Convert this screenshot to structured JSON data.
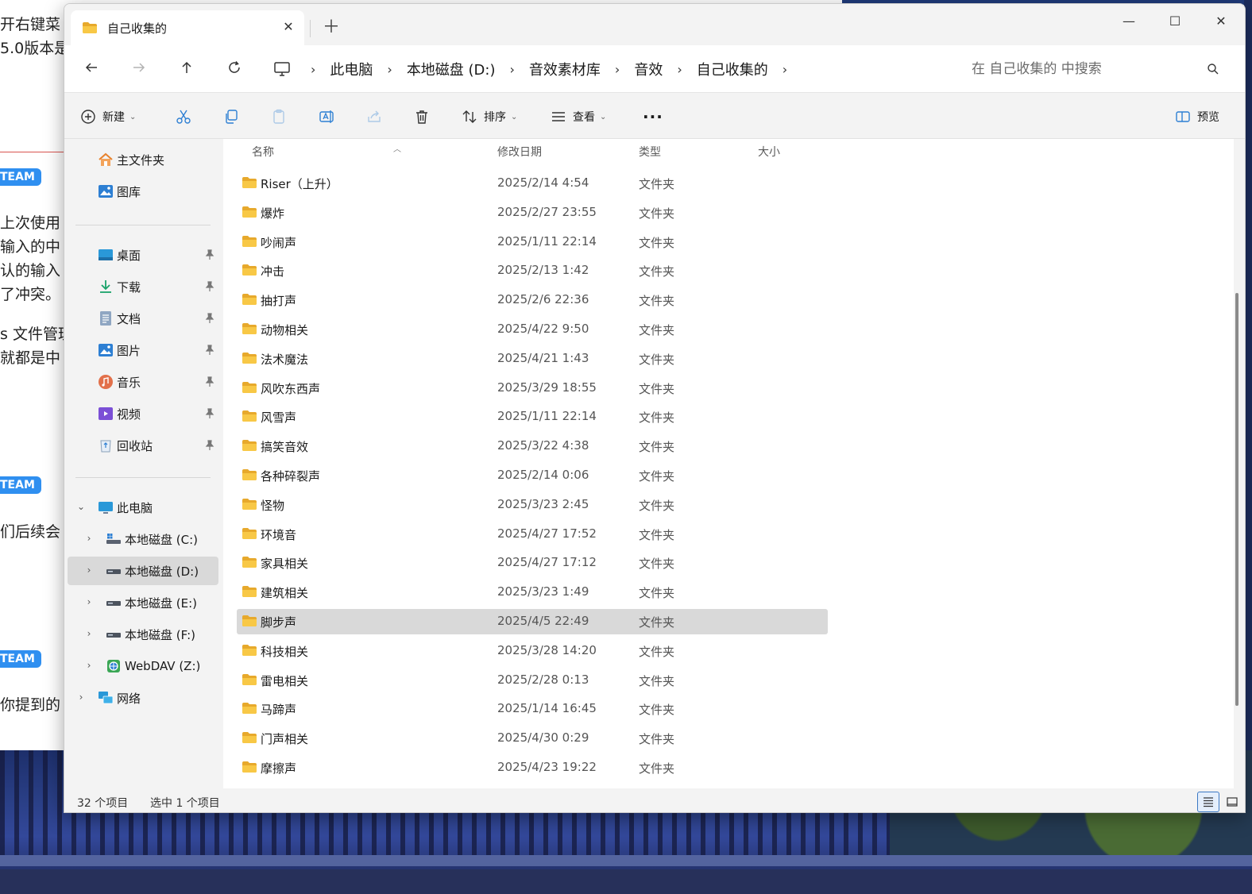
{
  "background": {
    "doc_lines": [
      "开右键菜",
      "5.0版本是",
      "上次使用",
      "输入的中",
      "认的输入",
      "了冲突。",
      "s 文件管理",
      "就都是中",
      "们后续会",
      "你提到的"
    ],
    "badges": [
      "TEAM",
      "TEAM",
      "TEAM"
    ]
  },
  "window": {
    "tab_title": "自己收集的",
    "tab_close": "✕",
    "new_tab": "＋",
    "controls": {
      "minimize": "—",
      "maximize": "☐",
      "close": "✕"
    }
  },
  "address": {
    "breadcrumbs": [
      "此电脑",
      "本地磁盘 (D:)",
      "音效素材库",
      "音效",
      "自己收集的"
    ],
    "separator": "›",
    "search_placeholder": "在 自己收集的 中搜索"
  },
  "commands": {
    "new": "新建",
    "sort": "排序",
    "view": "查看",
    "more": "···",
    "preview": "预览"
  },
  "sidebar": {
    "home": "主文件夹",
    "gallery": "图库",
    "quick_access": [
      "桌面",
      "下载",
      "文档",
      "图片",
      "音乐",
      "视频",
      "回收站"
    ],
    "this_pc": "此电脑",
    "drives": [
      "本地磁盘 (C:)",
      "本地磁盘 (D:)",
      "本地磁盘 (E:)",
      "本地磁盘 (F:)",
      "WebDAV (Z:)"
    ],
    "network": "网络",
    "selected_drive": "本地磁盘 (D:)"
  },
  "columns": {
    "name": "名称",
    "date": "修改日期",
    "type": "类型",
    "size": "大小"
  },
  "files": [
    {
      "name": "Riser（上升）",
      "date": "2025/2/14 4:54",
      "type": "文件夹"
    },
    {
      "name": "爆炸",
      "date": "2025/2/27 23:55",
      "type": "文件夹"
    },
    {
      "name": "吵闹声",
      "date": "2025/1/11 22:14",
      "type": "文件夹"
    },
    {
      "name": "冲击",
      "date": "2025/2/13 1:42",
      "type": "文件夹"
    },
    {
      "name": "抽打声",
      "date": "2025/2/6 22:36",
      "type": "文件夹"
    },
    {
      "name": "动物相关",
      "date": "2025/4/22 9:50",
      "type": "文件夹"
    },
    {
      "name": "法术魔法",
      "date": "2025/4/21 1:43",
      "type": "文件夹"
    },
    {
      "name": "风吹东西声",
      "date": "2025/3/29 18:55",
      "type": "文件夹"
    },
    {
      "name": "风雪声",
      "date": "2025/1/11 22:14",
      "type": "文件夹"
    },
    {
      "name": "搞笑音效",
      "date": "2025/3/22 4:38",
      "type": "文件夹"
    },
    {
      "name": "各种碎裂声",
      "date": "2025/2/14 0:06",
      "type": "文件夹"
    },
    {
      "name": "怪物",
      "date": "2025/3/23 2:45",
      "type": "文件夹"
    },
    {
      "name": "环境音",
      "date": "2025/4/27 17:52",
      "type": "文件夹"
    },
    {
      "name": "家具相关",
      "date": "2025/4/27 17:12",
      "type": "文件夹"
    },
    {
      "name": "建筑相关",
      "date": "2025/3/23 1:49",
      "type": "文件夹"
    },
    {
      "name": "脚步声",
      "date": "2025/4/5 22:49",
      "type": "文件夹",
      "selected": true
    },
    {
      "name": "科技相关",
      "date": "2025/3/28 14:20",
      "type": "文件夹"
    },
    {
      "name": "雷电相关",
      "date": "2025/2/28 0:13",
      "type": "文件夹"
    },
    {
      "name": "马蹄声",
      "date": "2025/1/14 16:45",
      "type": "文件夹"
    },
    {
      "name": "门声相关",
      "date": "2025/4/30 0:29",
      "type": "文件夹"
    },
    {
      "name": "摩擦声",
      "date": "2025/4/23 19:22",
      "type": "文件夹"
    }
  ],
  "status": {
    "count": "32 个项目",
    "selection": "选中 1 个项目"
  },
  "colors": {
    "folder": "#f8c846",
    "folder_dark": "#e7a92c",
    "accent": "#3b78c4",
    "selected_row": "#d9d9d9"
  }
}
